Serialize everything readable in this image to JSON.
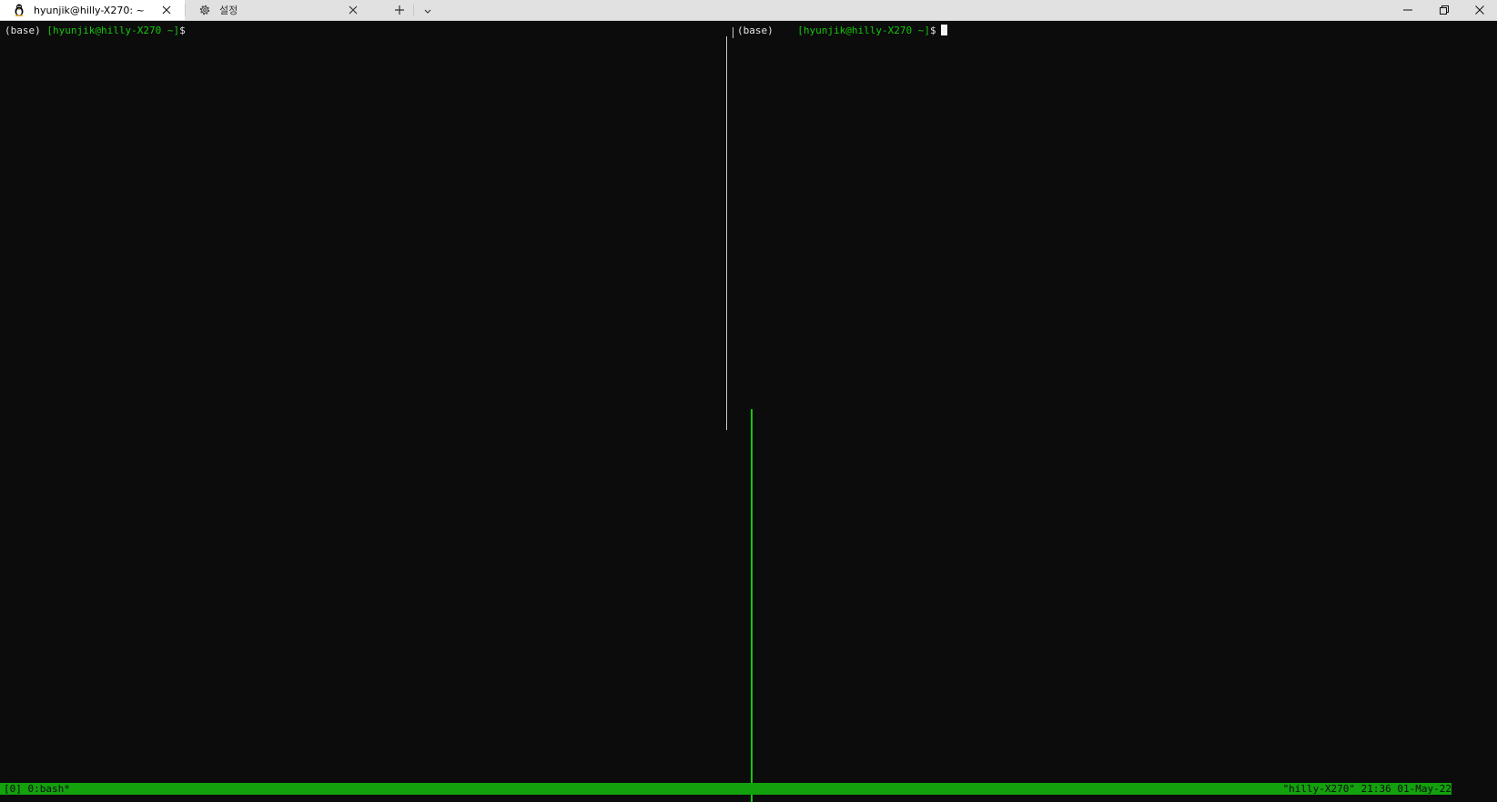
{
  "tabs": [
    {
      "title": "hyunjik@hilly-X270: ~",
      "icon": "linux-penguin-icon",
      "active": true
    },
    {
      "title": "설정",
      "icon": "gear-icon",
      "active": false
    }
  ],
  "window_controls": [
    "minimize",
    "maximize",
    "close"
  ],
  "panes": {
    "left": {
      "env": "(base)",
      "prompt": "[hyunjik@hilly-X270 ~]",
      "symbol": "$"
    },
    "right": {
      "env": "(base)",
      "prompt": "[hyunjik@hilly-X270 ~]",
      "symbol": "$"
    }
  },
  "status_bar": {
    "left": "[0] 0:bash*",
    "right": "\"hilly-X270\" 21:36 01-May-22"
  },
  "colors": {
    "prompt_green": "#16c60c",
    "status_bg": "#13a10e",
    "terminal_bg": "#0c0c0c"
  }
}
